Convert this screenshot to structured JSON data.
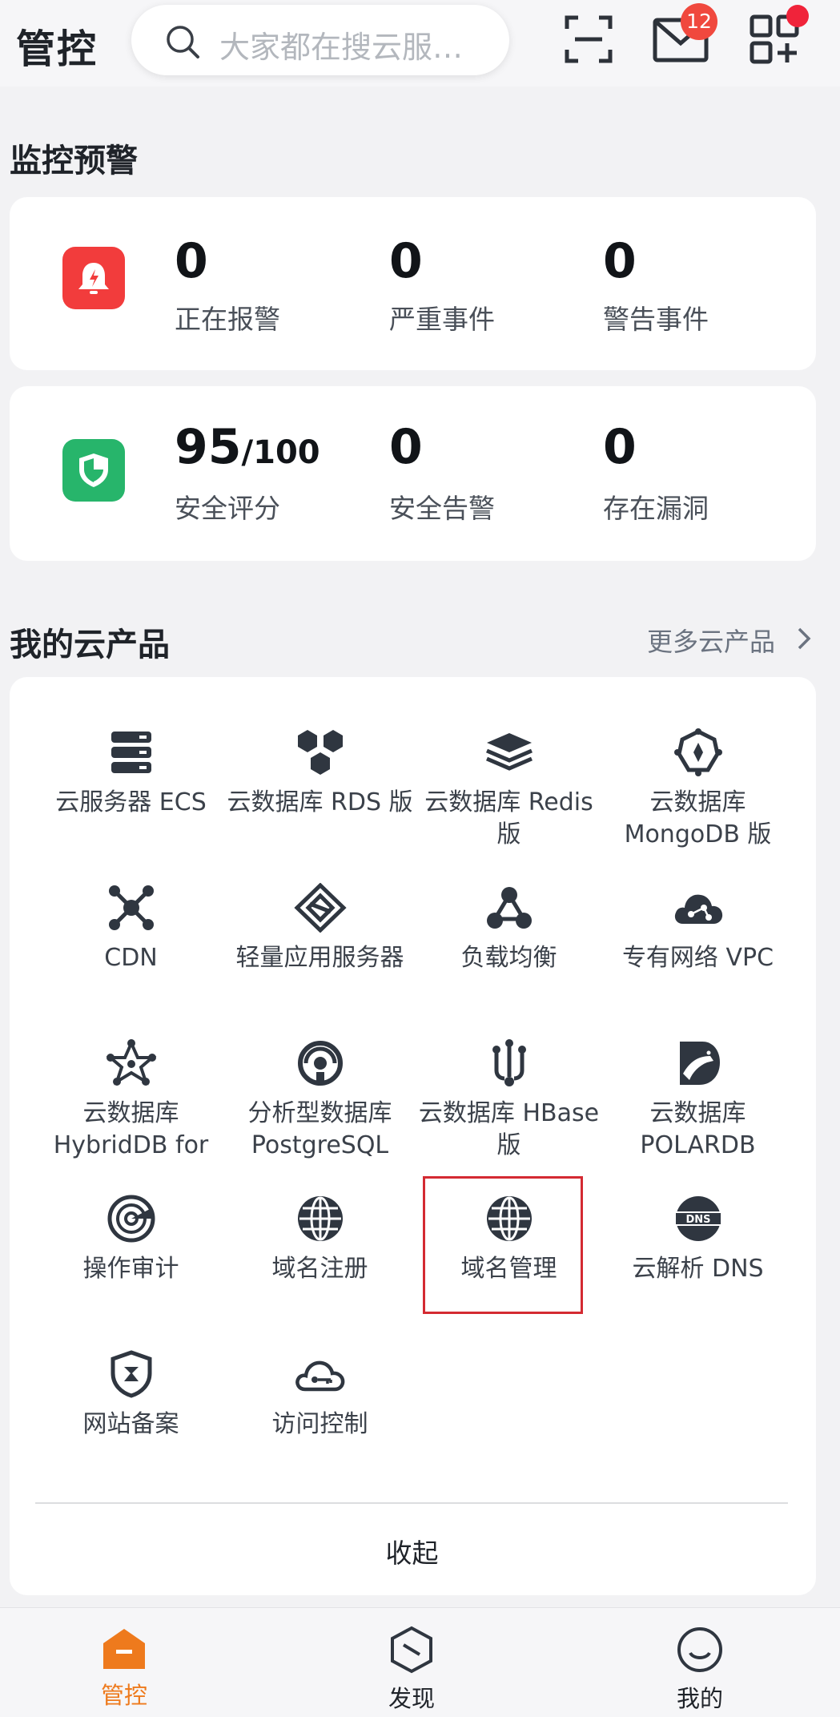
{
  "header": {
    "title": "管控",
    "search_placeholder": "大家都在搜云服…",
    "message_badge": "12"
  },
  "monitoring": {
    "title": "监控预警",
    "alarm_card": [
      {
        "value": "0",
        "label": "正在报警"
      },
      {
        "value": "0",
        "label": "严重事件"
      },
      {
        "value": "0",
        "label": "警告事件"
      }
    ],
    "security_card": {
      "score": "95",
      "score_total": "/100",
      "score_label": "安全评分",
      "items": [
        {
          "value": "0",
          "label": "安全告警"
        },
        {
          "value": "0",
          "label": "存在漏洞"
        }
      ]
    },
    "colors": {
      "alarm_icon_bg": "#f23c3c",
      "security_icon_bg": "#27b56b"
    }
  },
  "products": {
    "title": "我的云产品",
    "more_label": "更多云产品",
    "collapse_label": "收起",
    "items": [
      {
        "icon": "server-stack-icon",
        "label": "云服务器 ECS"
      },
      {
        "icon": "hexagon-cluster-icon",
        "label": "云数据库 RDS 版"
      },
      {
        "icon": "layers-icon",
        "label": "云数据库 Redis 版"
      },
      {
        "icon": "mongodb-icon",
        "label": "云数据库 MongoDB 版"
      },
      {
        "icon": "network-node-icon",
        "label": "CDN"
      },
      {
        "icon": "diamond-layers-icon",
        "label": "轻量应用服务器"
      },
      {
        "icon": "load-balance-icon",
        "label": "负载均衡"
      },
      {
        "icon": "cloud-network-icon",
        "label": "专有网络 VPC"
      },
      {
        "icon": "star-network-icon",
        "label": "云数据库 HybridDB for"
      },
      {
        "icon": "analytics-db-icon",
        "label": "分析型数据库 PostgreSQL"
      },
      {
        "icon": "hbase-icon",
        "label": "云数据库 HBase 版"
      },
      {
        "icon": "polardb-bear-icon",
        "label": "云数据库 POLARDB"
      },
      {
        "icon": "radar-icon",
        "label": "操作审计"
      },
      {
        "icon": "globe-icon",
        "label": "域名注册"
      },
      {
        "icon": "globe-icon",
        "label": "域名管理"
      },
      {
        "icon": "dns-icon",
        "label": "云解析 DNS"
      },
      {
        "icon": "filing-shield-icon",
        "label": "网站备案"
      },
      {
        "icon": "cloud-key-icon",
        "label": "访问控制"
      }
    ],
    "highlighted_item": "域名管理",
    "highlight_color": "#d42a32"
  },
  "tabbar": {
    "tabs": [
      {
        "label": "管控",
        "icon": "home-icon",
        "active": true
      },
      {
        "label": "发现",
        "icon": "discover-icon",
        "active": false
      },
      {
        "label": "我的",
        "icon": "profile-icon",
        "active": false
      }
    ],
    "active_color": "#ee7a1d"
  }
}
